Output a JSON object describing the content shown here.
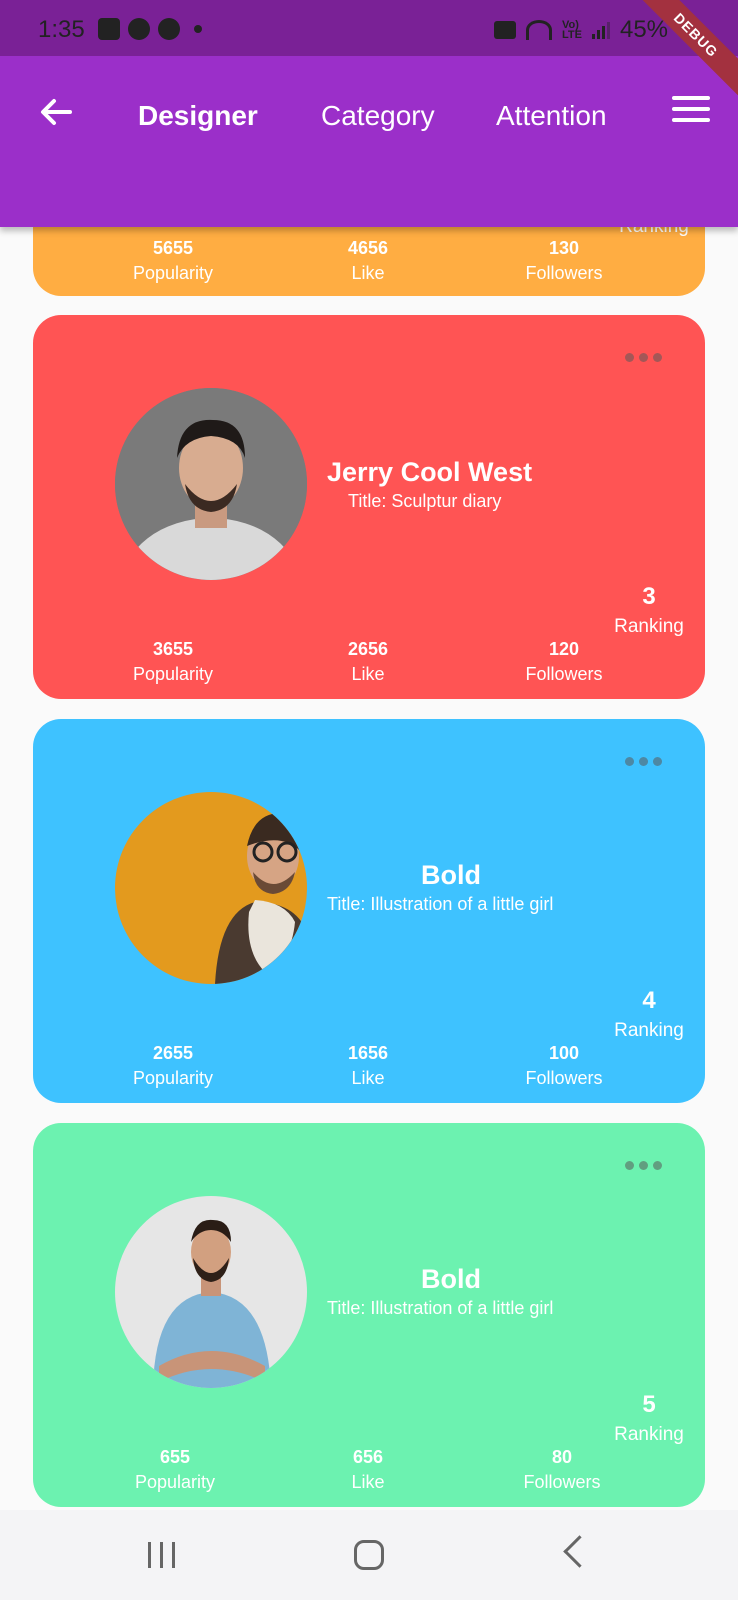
{
  "status_bar": {
    "time": "1:35",
    "battery": "45%",
    "network_label": "VoLTE"
  },
  "debug_banner": "DEBUG",
  "app_bar": {
    "tabs": [
      {
        "label": "Designer",
        "active": true
      },
      {
        "label": "Category",
        "active": false
      },
      {
        "label": "Attention",
        "active": false
      }
    ]
  },
  "cards": [
    {
      "name": "",
      "title": "",
      "ranking": "",
      "ranking_label": "Ranking",
      "color": "#ffad42",
      "stats": [
        {
          "value": "5655",
          "label": "Popularity"
        },
        {
          "value": "4656",
          "label": "Like"
        },
        {
          "value": "130",
          "label": "Followers"
        }
      ]
    },
    {
      "name": "Jerry Cool West",
      "title": "Title: Sculptur diary",
      "ranking": "3",
      "ranking_label": "Ranking",
      "color": "#ff5454",
      "stats": [
        {
          "value": "3655",
          "label": "Popularity"
        },
        {
          "value": "2656",
          "label": "Like"
        },
        {
          "value": "120",
          "label": "Followers"
        }
      ]
    },
    {
      "name": "Bold",
      "title": "Title: Illustration of a little girl",
      "ranking": "4",
      "ranking_label": "Ranking",
      "color": "#3ec2ff",
      "stats": [
        {
          "value": "2655",
          "label": "Popularity"
        },
        {
          "value": "1656",
          "label": "Like"
        },
        {
          "value": "100",
          "label": "Followers"
        }
      ]
    },
    {
      "name": "Bold",
      "title": "Title: Illustration of a little girl",
      "ranking": "5",
      "ranking_label": "Ranking",
      "color": "#6cf2b0",
      "stats": [
        {
          "value": "655",
          "label": "Popularity"
        },
        {
          "value": "656",
          "label": "Like"
        },
        {
          "value": "80",
          "label": "Followers"
        }
      ]
    }
  ],
  "colors": {
    "app_bar": "#9b2fc9",
    "status_bar": "#7a2196"
  }
}
